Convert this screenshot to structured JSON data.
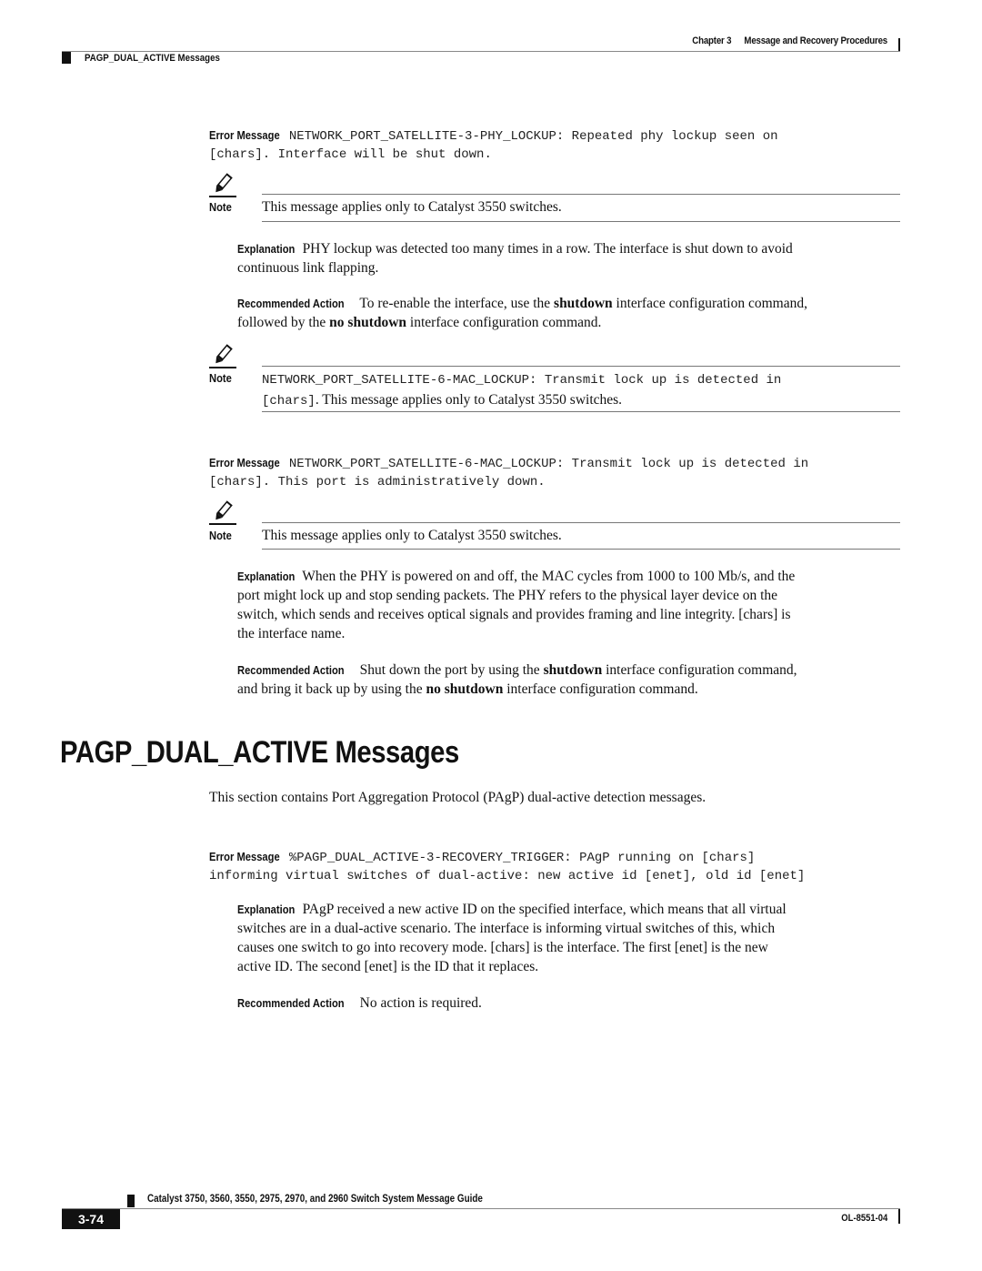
{
  "header": {
    "chapter": "Chapter 3",
    "chapter_title": "Message and Recovery Procedures",
    "section": "PAGP_DUAL_ACTIVE Messages"
  },
  "labels": {
    "error_message": "Error Message",
    "note": "Note",
    "explanation": "Explanation",
    "recommended_action": "Recommended Action"
  },
  "entries": [
    {
      "error_code": "NETWORK_PORT_SATELLITE-3-PHY_LOCKUP: Repeated phy lockup seen on",
      "error_cont": "[chars]. Interface will be shut down.",
      "note": "This message applies only to Catalyst 3550 switches.",
      "explanation_l1": "PHY lockup was detected too many times in a row. The interface is shut down to avoid",
      "explanation_l2": "continuous link flapping.",
      "action_pre": "To re-enable the interface, use the ",
      "action_b1": "shutdown",
      "action_mid": " interface configuration command,",
      "action_l2_pre": "followed by the ",
      "action_b2": "no shutdown",
      "action_post": " interface configuration command.",
      "note2_code": "NETWORK_PORT_SATELLITE-6-MAC_LOCKUP: Transmit lock up is detected in",
      "note2_chars": "[chars]",
      "note2_text": ".  This message applies only to Catalyst 3550 switches."
    },
    {
      "error_code": "NETWORK_PORT_SATELLITE-6-MAC_LOCKUP: Transmit lock up is detected in",
      "error_cont": "[chars]. This port is administratively down.",
      "note": "This message applies only to Catalyst 3550 switches.",
      "explanation_l1": "When the PHY is powered on and off, the MAC cycles from 1000 to 100 Mb/s, and the",
      "explanation_l2": "port might lock up and stop sending packets. The PHY refers to the physical layer device on the",
      "explanation_l3": "switch, which sends and receives optical signals and provides framing and line integrity. [chars] is",
      "explanation_l4": "the interface name.",
      "action_pre": "Shut down the port by using the ",
      "action_b1": "shutdown",
      "action_mid": " interface configuration command,",
      "action_l2_pre": "and bring it back up by using the ",
      "action_b2": "no shutdown",
      "action_post": " interface configuration command."
    }
  ],
  "section": {
    "title": "PAGP_DUAL_ACTIVE Messages",
    "intro": "This section contains Port Aggregation Protocol (PAgP) dual-active detection messages.",
    "error_code": "%PAGP_DUAL_ACTIVE-3-RECOVERY_TRIGGER: PAgP running on [chars]",
    "error_cont": "informing virtual switches of dual-active: new active id [enet], old id [enet]",
    "explanation_l1": "PAgP received a new active ID on the specified interface, which means that all virtual",
    "explanation_l2": "switches are in a dual-active scenario. The interface is informing virtual switches of this, which",
    "explanation_l3": "causes one switch to go into recovery mode. [chars] is the interface. The first [enet] is the new",
    "explanation_l4": "active ID. The second [enet] is the ID that it replaces.",
    "action": "No action is required."
  },
  "footer": {
    "guide_title": "Catalyst 3750, 3560, 3550, 2975, 2970, and 2960 Switch System Message Guide",
    "page": "3-74",
    "doc_id": "OL-8551-04"
  }
}
